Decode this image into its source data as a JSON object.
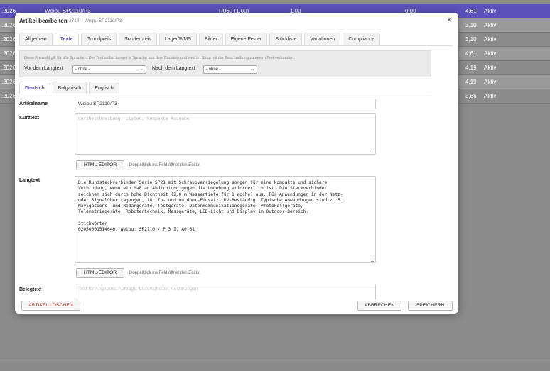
{
  "background_rows": [
    {
      "c1": ".2026",
      "name": "Weipu SP2110/P3",
      "code": "R069 (1,00)",
      "v1": "1,00",
      "v2": "0,00",
      "price": "4,61",
      "status": "Aktiv"
    },
    {
      "c1": ".2026",
      "price": "3,10",
      "status": "Aktiv"
    },
    {
      "c1": ".2026",
      "price": "3,10",
      "status": "Aktiv"
    },
    {
      "c1": ".2026",
      "price": "4,61",
      "status": "Aktiv"
    },
    {
      "c1": ".2026",
      "price": "4,19",
      "status": "Aktiv"
    },
    {
      "c1": ".2026",
      "price": "4,19",
      "status": "Aktiv"
    },
    {
      "c1": ".2026",
      "price": "3,86",
      "status": "Aktiv"
    }
  ],
  "modal": {
    "title": "Artikel bearbeiten",
    "subtitle": "3714 – Weipu SP2110/P3",
    "close_symbol": "×"
  },
  "tabs": [
    "Allgemein",
    "Texte",
    "Grundpreis",
    "Sonderpreis",
    "Lager/WMS",
    "Bilder",
    "Eigene Felder",
    "Stückliste",
    "Variationen",
    "Compliance"
  ],
  "info": {
    "note": "Diese Auswahl gilt für alle Sprachen. Der Text selbst kommt je Sprache aus dem Baustein und wird im Shop mit der Beschreibung zu einem Text verbunden.",
    "before_label": "Vor dem Langtext",
    "before_value": "- ohne -",
    "after_label": "Nach dem Langtext",
    "after_value": "- ohne -"
  },
  "lang_tabs": [
    "Deutsch",
    "Bulgarisch",
    "Englisch"
  ],
  "fields": {
    "articlename_label": "Artikelname",
    "articlename_value": "Weipu SP2110/P3",
    "kurztext_label": "Kurztext",
    "kurztext_placeholder": "Kurzbeschreibung, Listen, kompakte Ausgabe",
    "langtext_label": "Langtext",
    "langtext_value": "Die Rundsteckverbinder Serie SP21 mit Schraubverriegelung sorgen für eine kompakte und sichere\nVerbindung, wenn ein Maß an Abdichtung gegen die Umgebung erforderlich ist. Die Steckverbinder\nzeichnen sich durch hohe Dichtheit (2,0 m Wassertiefe für 1 Woche) aus. Für Anwendungen in der Netz-\noder Signalübertragungen, für In- und Outdoor-Einsatz. UV-Beständig. Typische Anwendungen sind z. B.\nNavigations- und Radargeräte, Testgeräte, Datenkommunikationsgeräte, Protokollgeräte,\nTelemetriegeräte, Robotertechnik, Messgeräte, LED-Licht und Display im Outdoor-Bereich.\n\nStichwörter\n02050001514646, Weipu, SP2110 / P 3 I, A0-61",
    "belegtext_label": "Belegtext",
    "belegtext_placeholder": "Text für Angebote, Aufträge, Lieferscheine, Rechnungen"
  },
  "editor": {
    "button": "HTML-EDITOR",
    "hint": "Doppelklick ins Feld öffnet den Editor."
  },
  "footer": {
    "delete": "ARTIKEL LÖSCHEN",
    "cancel": "ABBRECHEN",
    "save": "SPEICHERN"
  },
  "colors": {
    "accent": "#5a4fcf",
    "selected_row": "#5a52b8",
    "delete_text": "#c0392b"
  }
}
